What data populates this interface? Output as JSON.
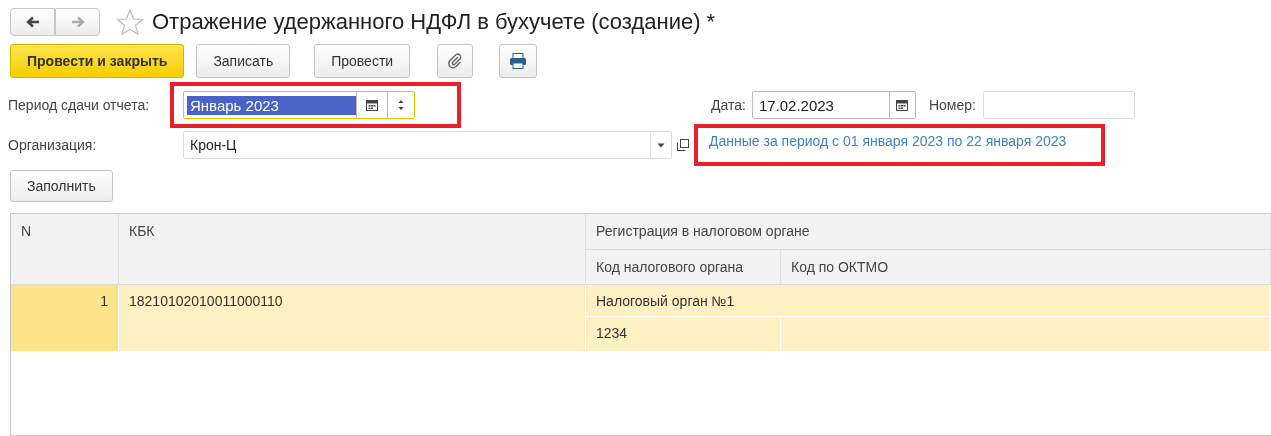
{
  "window": {
    "title": "Отражение удержанного НДФЛ в бухучете (создание) *",
    "starred": false
  },
  "toolbar": [
    {
      "kind": "primary",
      "label": "Провести и закрыть"
    },
    {
      "kind": "normal",
      "label": "Записать"
    },
    {
      "kind": "normal",
      "label": "Провести"
    },
    {
      "kind": "attach"
    },
    {
      "kind": "print"
    }
  ],
  "period": {
    "label": "Период сдачи отчета:",
    "value": "Январь 2023",
    "selected": true,
    "highlighted": true
  },
  "date": {
    "label": "Дата:",
    "value": "17.02.2023"
  },
  "number": {
    "label": "Номер:"
  },
  "organization": {
    "label": "Организация:",
    "value": "Крон-Ц"
  },
  "period_link": {
    "text": "Данные за период с 01 января 2023 по 22 января 2023",
    "highlighted": true
  },
  "fill_button": "Заполнить",
  "table": {
    "columns": [
      "N",
      "КБК"
    ],
    "group": "Регистрация в налоговом органе",
    "subcolumns": [
      "Код налогового органа",
      "Код по ОКТМО"
    ],
    "rows": [
      {
        "n": "1",
        "kbk": "18210102010011000110",
        "tax_authority": "Налоговый орган №1",
        "tax_code": "1234",
        "selected": true
      }
    ]
  }
}
